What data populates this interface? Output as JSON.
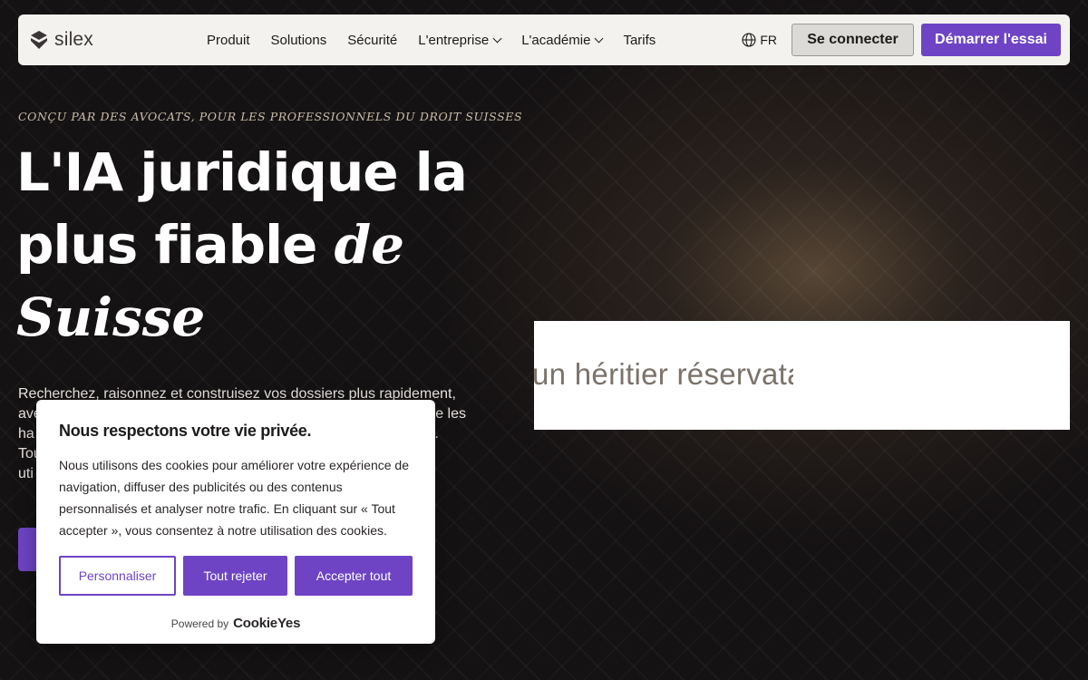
{
  "nav": {
    "logo_text": "silex",
    "links": [
      "Produit",
      "Solutions",
      "Sécurité",
      "L'entreprise",
      "L'académie",
      "Tarifs"
    ],
    "lang": "FR",
    "login_label": "Se connecter",
    "trial_label": "Démarrer l'essai"
  },
  "hero": {
    "eyebrow": "CONÇU PAR DES AVOCATS, POUR LES PROFESSIONNELS DU DROIT SUISSES",
    "headline_part1": "L'IA juridique la plus fiable ",
    "headline_serif": "de Suisse",
    "subtext_line1": "Recherchez, raisonnez et construisez vos dossiers plus rapidement,",
    "subtext_line2": "ave",
    "subtext_line2_end": "e les",
    "subtext_line3": "ha",
    "subtext_line3_end": ".",
    "subtext_line4": "Tou",
    "subtext_line5": "uti"
  },
  "panel": {
    "typing_text": "un héritier réservataire"
  },
  "cookie": {
    "title": "Nous respectons votre vie privée.",
    "body": "Nous utilisons des cookies pour améliorer votre expérience de navigation, diffuser des publicités ou des contenus personnalisés et analyser notre trafic. En cliquant sur « Tout accepter », vous consentez à notre utilisation des cookies.",
    "customize_label": "Personnaliser",
    "reject_label": "Tout rejeter",
    "accept_label": "Accepter tout",
    "powered_by": "Powered by",
    "powered_brand": "CookieYes"
  },
  "colors": {
    "accent": "#6e44c5",
    "background": "#151213",
    "navbar": "#f4f2ee"
  }
}
